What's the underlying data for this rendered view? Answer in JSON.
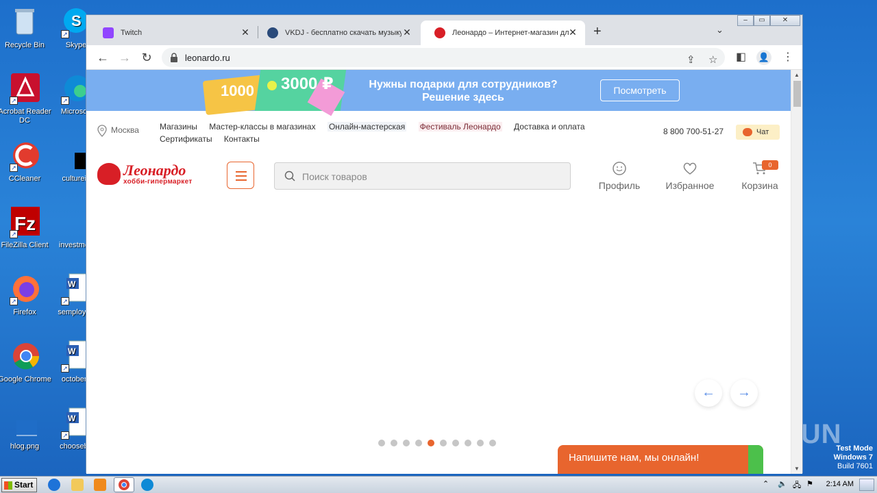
{
  "desktop": {
    "icons": [
      {
        "label": "Recycle Bin"
      },
      {
        "label": "Skype"
      },
      {
        "label": "Acrobat Reader DC"
      },
      {
        "label": "Microsoft"
      },
      {
        "label": "CCleaner"
      },
      {
        "label": "cultureis"
      },
      {
        "label": "FileZilla Client"
      },
      {
        "label": "investmen"
      },
      {
        "label": "Firefox"
      },
      {
        "label": "semployee"
      },
      {
        "label": "Google Chrome"
      },
      {
        "label": "octoberc"
      },
      {
        "label": "hlog.png"
      },
      {
        "label": "chooseba"
      }
    ]
  },
  "browser": {
    "tabs": [
      {
        "title": "Twitch",
        "icon": "twitch-icon",
        "color": "#9146ff"
      },
      {
        "title": "VKDJ - бесплатно скачать музыку",
        "icon": "vkdj-icon",
        "color": "#2a4a7a"
      },
      {
        "title": "Леонардо – Интернет-магазин для",
        "icon": "leonardo-icon",
        "color": "#d81f26"
      }
    ],
    "url": "leonardo.ru"
  },
  "site": {
    "banner": {
      "amount1": "1000",
      "amount2": "3000 ₽",
      "title_line1": "Нужны подарки для сотрудников?",
      "title_line2": "Решение здесь",
      "button": "Посмотреть"
    },
    "city": "Москва",
    "nav": [
      "Магазины",
      "Мастер-классы в магазинах",
      "Онлайн-мастерская",
      "Фестиваль Леонардо",
      "Доставка и оплата",
      "Сертификаты",
      "Контакты"
    ],
    "phone": "8 800 700-51-27",
    "chat": "Чат",
    "logo": {
      "name": "Леонардо",
      "tagline": "хобби-гипермаркет"
    },
    "search_placeholder": "Поиск товаров",
    "profile": "Профиль",
    "favorites": "Избранное",
    "cart": "Корзина",
    "cart_count": "0",
    "slider": {
      "total": 10,
      "active": 5
    },
    "chat_widget": "Напишите нам, мы онлайн!"
  },
  "taskbar": {
    "start": "Start",
    "clock": "2:14 AM"
  },
  "watermark": {
    "line1": "Test Mode",
    "line2": "Windows 7",
    "line3": "Build 7601",
    "brand": "ANY RUN"
  },
  "colors": {
    "accent": "#e8652e",
    "brand_red": "#d81f26",
    "banner_blue": "#79aef0"
  }
}
